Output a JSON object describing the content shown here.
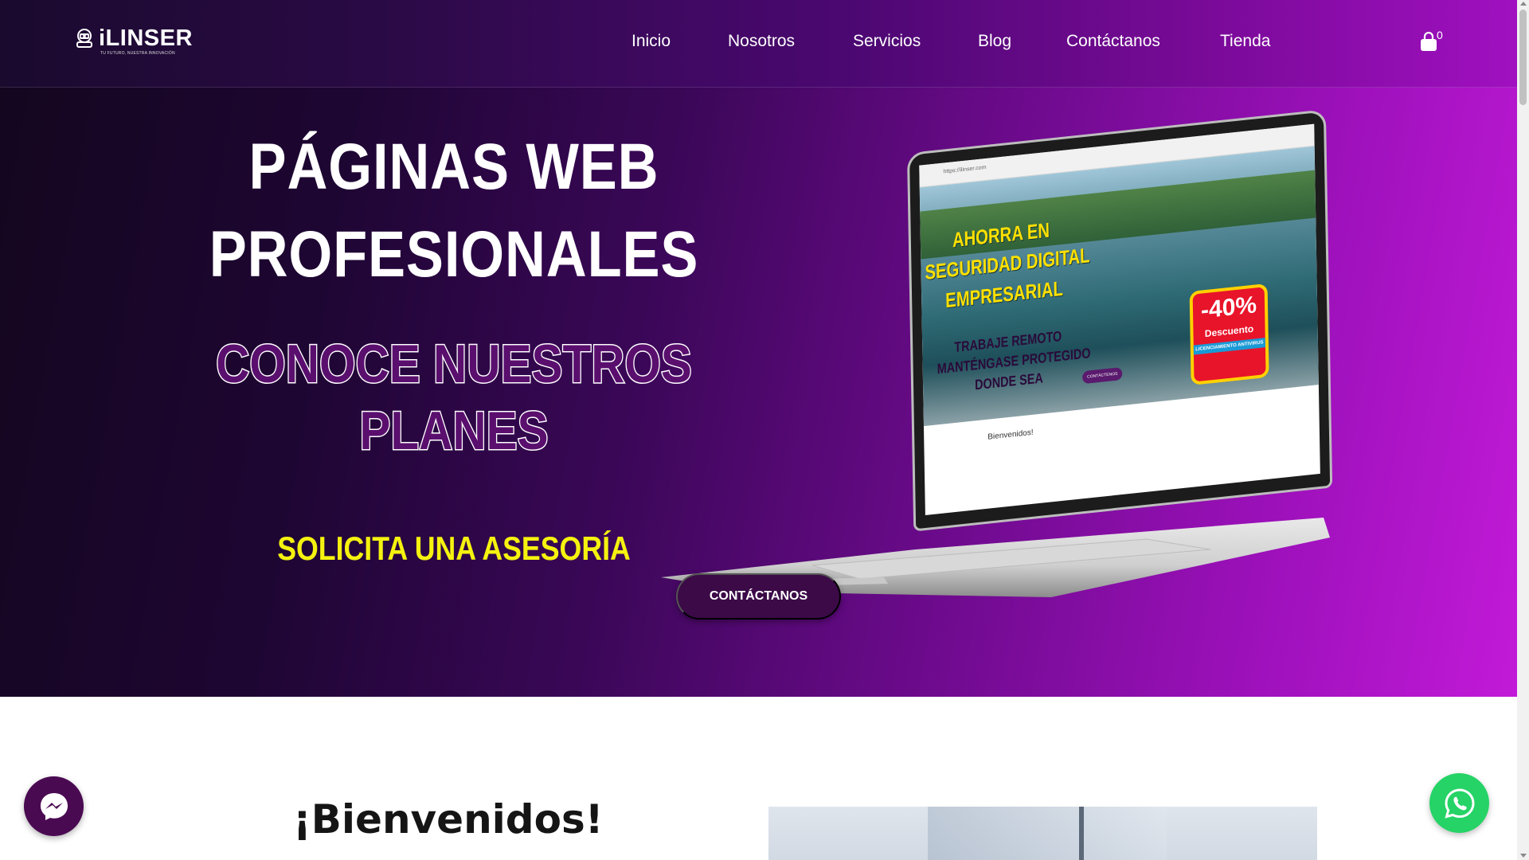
{
  "header": {
    "logo_text": "iLINSER",
    "logo_tagline": "TU FUTURO, NUESTRA INNOVACIÓN",
    "nav": [
      {
        "label": "Inicio"
      },
      {
        "label": "Nosotros"
      },
      {
        "label": "Servicios"
      },
      {
        "label": "Blog"
      },
      {
        "label": "Contáctanos"
      },
      {
        "label": "Tienda"
      }
    ],
    "cart_count": "0",
    "cart_icon": "shopping-bag-icon"
  },
  "hero": {
    "title_line1": "PÁGINAS WEB",
    "title_line2": "PROFESIONALES",
    "subtitle_line1": "CONOCE NUESTROS",
    "subtitle_line2": "PLANES",
    "cta_text": "SOLICITA UNA ASESORÍA",
    "button_label": "CONTÁCTANOS",
    "laptop_screen": {
      "url": "https://ilinser.com",
      "banner_line1": "AHORRA EN",
      "banner_line2": "SEGURIDAD DIGITAL",
      "banner_line3": "EMPRESARIAL",
      "banner_small1": "TRABAJE REMOTO",
      "banner_small2": "MANTÉNGASE PROTEGIDO",
      "banner_small3": "DONDE SEA",
      "discount_pct": "-40%",
      "discount_label": "Descuento",
      "discount_small": "LICENCIAMIENTO ANTIVIRUS",
      "banner_button": "CONTÁCTENOS",
      "below_banner": "Bienvenidos!"
    }
  },
  "welcome": {
    "heading": "¡Bienvenidos!"
  },
  "widgets": {
    "messenger_icon": "messenger-icon",
    "whatsapp_icon": "whatsapp-icon"
  },
  "colors": {
    "hero_gradient_start": "#14061f",
    "hero_gradient_end": "#c21ad8",
    "subtitle_fill": "#5a0f6e",
    "cta_yellow": "#f5f20f",
    "button_bg": "#3b0a47",
    "whatsapp_green": "#25d366",
    "messenger_bg": "#4a0a52"
  }
}
